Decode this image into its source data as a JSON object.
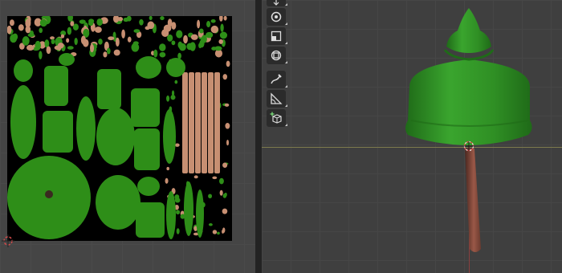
{
  "uv_editor": {
    "texture_colors": {
      "background": "#000000",
      "foliage": "#2e8e18",
      "bark": "#c78f72"
    },
    "cursor_icon": "3d-cursor-icon"
  },
  "viewport": {
    "colors": {
      "canopy": "#339a2a",
      "canopy_shadow": "#1f6a18",
      "trunk": "#8a4b3b",
      "horizon_line": "#7d7a4e",
      "z_axis": "#8a3f3f"
    },
    "toolbar": [
      {
        "icon": "move-icon"
      },
      {
        "icon": "rotate-icon"
      },
      {
        "icon": "scale-icon"
      },
      {
        "icon": "transform-icon"
      },
      {
        "icon": "annotate-icon"
      },
      {
        "icon": "measure-icon"
      },
      {
        "icon": "add-cube-icon"
      }
    ],
    "origin_icon": "object-origin-icon"
  }
}
